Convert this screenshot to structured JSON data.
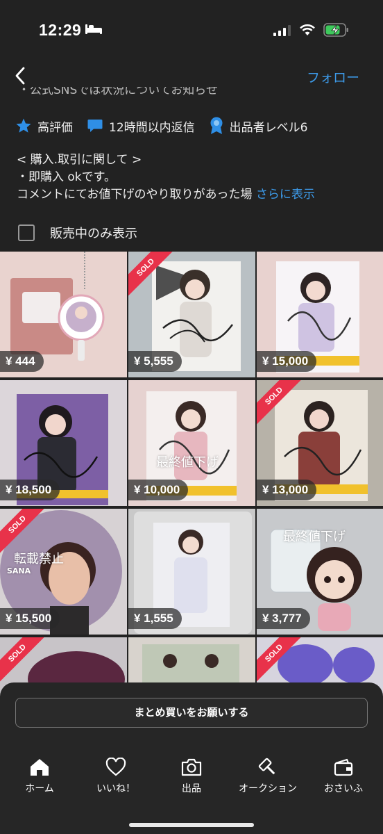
{
  "status_bar": {
    "time": "12:29"
  },
  "nav": {
    "follow_label": "フォロー"
  },
  "profile": {
    "cut_text": "・公式SNSでは状況についてお知らせ",
    "badges": [
      {
        "label": "高評価",
        "icon": "star-icon"
      },
      {
        "label": "12時間以内返信",
        "icon": "chat-icon"
      },
      {
        "label": "出品者レベル6",
        "icon": "medal-icon"
      }
    ],
    "description_lines": [
      "< 購入.取引に関して >",
      "・即購入 okです。",
      " コメントにてお値下げのやり取りがあった場"
    ],
    "more_label": "さらに表示"
  },
  "filter": {
    "label": "販売中のみ表示",
    "checked": false
  },
  "items": [
    {
      "price": "¥ 444",
      "sold": false,
      "overlay": ""
    },
    {
      "price": "¥ 5,555",
      "sold": true,
      "overlay": ""
    },
    {
      "price": "¥ 15,000",
      "sold": false,
      "overlay": ""
    },
    {
      "price": "¥ 18,500",
      "sold": false,
      "overlay": ""
    },
    {
      "price": "¥ 10,000",
      "sold": false,
      "overlay": "最終値下げ"
    },
    {
      "price": "¥ 13,000",
      "sold": true,
      "overlay": ""
    },
    {
      "price": "¥ 15,500",
      "sold": true,
      "overlay": "転載禁止"
    },
    {
      "price": "¥ 1,555",
      "sold": false,
      "overlay": ""
    },
    {
      "price": "¥ 3,777",
      "sold": false,
      "overlay": "最終値下げ"
    },
    {
      "price": "",
      "sold": true,
      "overlay": ""
    },
    {
      "price": "",
      "sold": false,
      "overlay": ""
    },
    {
      "price": "",
      "sold": true,
      "overlay": ""
    }
  ],
  "sold_label": "SOLD",
  "sana_label": "SANA",
  "bulk_button": {
    "label": "まとめ買いをお願いする"
  },
  "tabs": [
    {
      "label": "ホーム",
      "icon": "home-icon"
    },
    {
      "label": "いいね！",
      "icon": "heart-icon"
    },
    {
      "label": "出品",
      "icon": "camera-icon"
    },
    {
      "label": "オークション",
      "icon": "gavel-icon"
    },
    {
      "label": "おさいふ",
      "icon": "wallet-icon"
    }
  ],
  "colors": {
    "accent": "#3d9bea",
    "sold": "#e8324a",
    "background": "#222222"
  }
}
